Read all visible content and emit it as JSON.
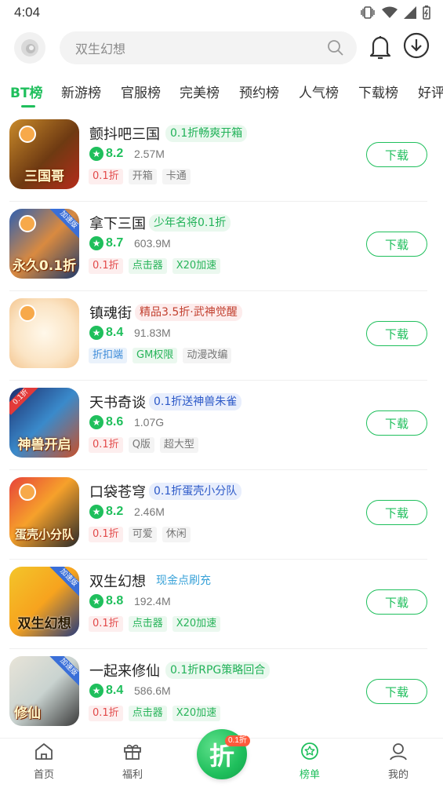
{
  "status": {
    "time": "4:04"
  },
  "search": {
    "placeholder": "双生幻想"
  },
  "tabs": [
    {
      "label": "BT榜"
    },
    {
      "label": "新游榜"
    },
    {
      "label": "官服榜"
    },
    {
      "label": "完美榜"
    },
    {
      "label": "预约榜"
    },
    {
      "label": "人气榜"
    },
    {
      "label": "下载榜"
    },
    {
      "label": "好评"
    }
  ],
  "games": [
    {
      "name": "颤抖吧三国",
      "promo": "0.1折畅爽开箱",
      "rating": "8.2",
      "size": "2.57M",
      "tags": [
        "0.1折",
        "开箱",
        "卡通"
      ],
      "thumb_text": "三国哥",
      "download": "下载"
    },
    {
      "name": "拿下三国",
      "promo": "少年名将0.1折",
      "rating": "8.7",
      "size": "603.9M",
      "tags": [
        "0.1折",
        "点击器",
        "X20加速"
      ],
      "thumb_text": "永久0.1折",
      "speed_badge": "加速版",
      "download": "下载"
    },
    {
      "name": "镇魂街",
      "promo": "精品3.5折·武神觉醒",
      "rating": "8.4",
      "size": "91.83M",
      "tags": [
        "折扣端",
        "GM权限",
        "动漫改编"
      ],
      "thumb_text": "",
      "download": "下载"
    },
    {
      "name": "天书奇谈",
      "promo": "0.1折送神兽朱雀",
      "rating": "8.6",
      "size": "1.07G",
      "tags": [
        "0.1折",
        "Q版",
        "超大型"
      ],
      "thumb_text": "神兽开启",
      "corner_badge": "0.1折",
      "download": "下载"
    },
    {
      "name": "口袋苍穹",
      "promo": "0.1折蛋壳小分队",
      "rating": "8.2",
      "size": "2.46M",
      "tags": [
        "0.1折",
        "可爱",
        "休闲"
      ],
      "thumb_text": "蛋壳小分队",
      "download": "下载"
    },
    {
      "name": "双生幻想",
      "promo": "现金点刷充",
      "rating": "8.8",
      "size": "192.4M",
      "tags": [
        "0.1折",
        "点击器",
        "X20加速"
      ],
      "thumb_text": "双生幻想",
      "speed_badge": "加速版",
      "download": "下载"
    },
    {
      "name": "一起来修仙",
      "promo": "0.1折RPG策略回合",
      "rating": "8.4",
      "size": "586.6M",
      "tags": [
        "0.1折",
        "点击器",
        "X20加速"
      ],
      "thumb_text": "修仙",
      "speed_badge": "加速版",
      "download": "下载"
    }
  ],
  "bottom_nav": {
    "home": "首页",
    "welfare": "福利",
    "center": "折",
    "center_badge": "0.1折",
    "ranking": "榜单",
    "mine": "我的"
  },
  "colors": {
    "accent": "#1fbf5c"
  }
}
